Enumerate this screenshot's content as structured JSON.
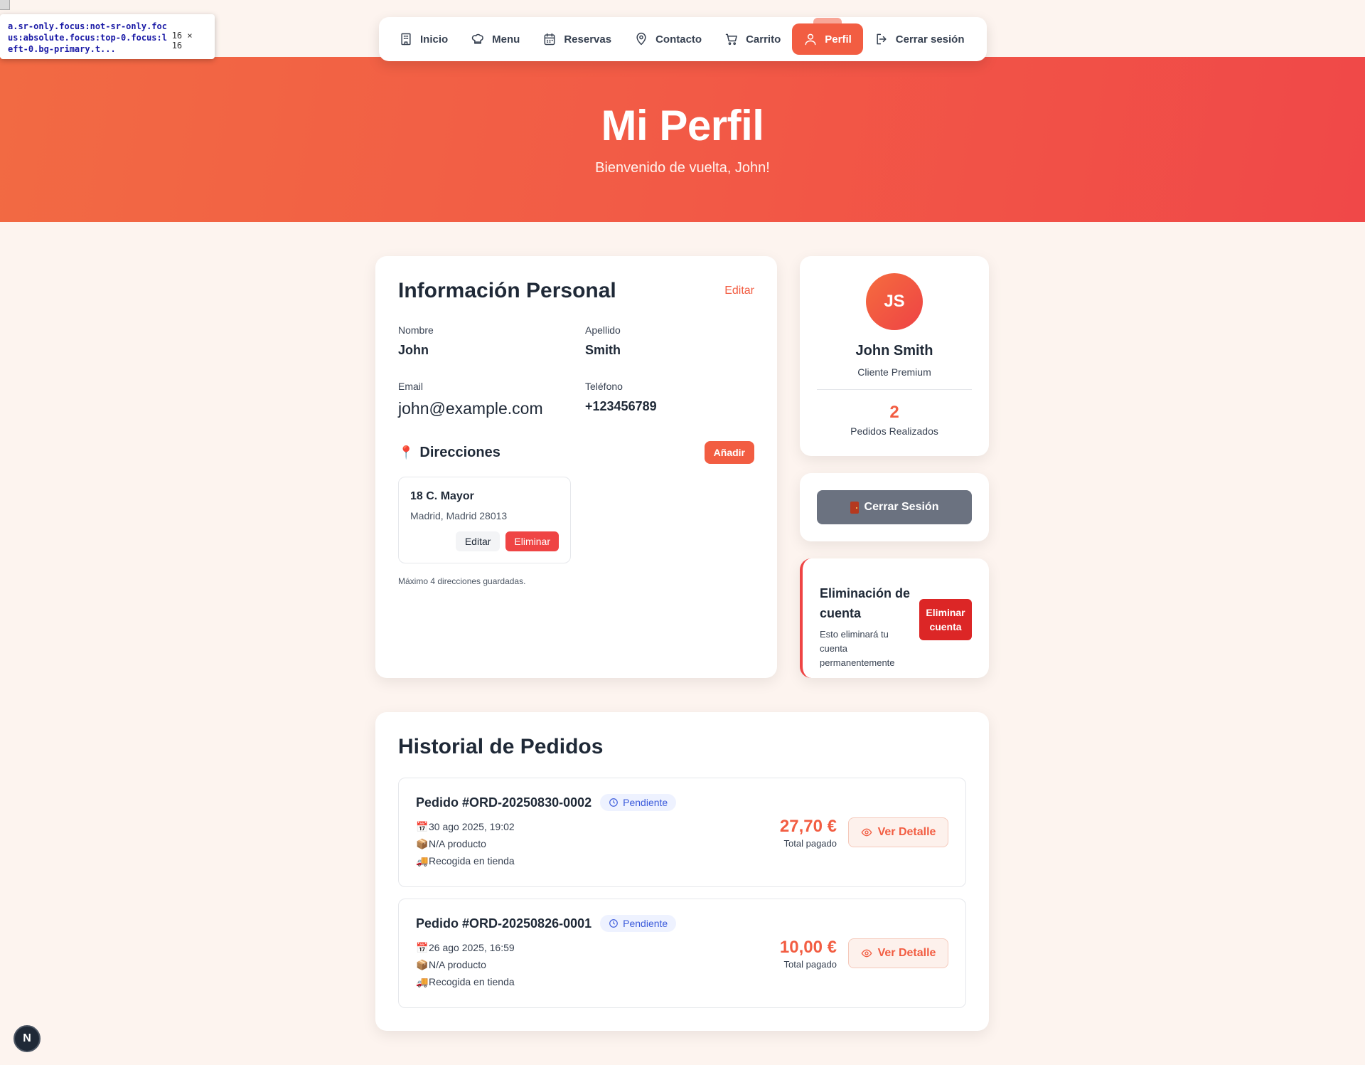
{
  "devtools": {
    "selector": "a.sr-only.focus:not-sr-only.focus:absolute.focus:top-0.focus:left-0.bg-primary.t...",
    "size": "16 × 16"
  },
  "nav": {
    "items": [
      {
        "label": "Inicio",
        "icon": "building-icon"
      },
      {
        "label": "Menu",
        "icon": "chef-hat-icon"
      },
      {
        "label": "Reservas",
        "icon": "calendar-icon"
      },
      {
        "label": "Contacto",
        "icon": "map-pin-icon"
      },
      {
        "label": "Carrito",
        "icon": "cart-icon"
      },
      {
        "label": "Perfil",
        "icon": "user-icon",
        "active": true
      },
      {
        "label": "Cerrar sesión",
        "icon": "logout-icon"
      }
    ]
  },
  "hero": {
    "title": "Mi Perfil",
    "subtitle": "Bienvenido de vuelta, John!"
  },
  "personal": {
    "title": "Información Personal",
    "edit_label": "Editar",
    "fields": {
      "nombre_label": "Nombre",
      "nombre": "John",
      "apellido_label": "Apellido",
      "apellido": "Smith",
      "email_label": "Email",
      "email": "john@example.com",
      "telefono_label": "Teléfono",
      "telefono": "+123456789"
    },
    "addresses_title": "Direcciones",
    "add_label": "Añadir",
    "addresses": [
      {
        "street": "18 C. Mayor",
        "city": "Madrid, Madrid 28013",
        "edit": "Editar",
        "delete": "Eliminar"
      }
    ],
    "hint": "Máximo 4 direcciones guardadas."
  },
  "profile": {
    "initials": "JS",
    "name": "John Smith",
    "tier": "Cliente Premium",
    "orders_count": "2",
    "orders_label": "Pedidos Realizados"
  },
  "logout": {
    "label": "Cerrar Sesión"
  },
  "danger": {
    "title": "Eliminación de cuenta",
    "subtitle": "Esto eliminará tu cuenta permanentemente",
    "button": "Eliminar cuenta"
  },
  "orders": {
    "title": "Historial de Pedidos",
    "items": [
      {
        "id": "Pedido #ORD-20250830-0002",
        "status": "Pendiente",
        "date": "30 ago 2025, 19:02",
        "products": "N/A producto",
        "delivery": "Recogida en tienda",
        "total": "27,70 €",
        "total_label": "Total pagado",
        "action": "Ver Detalle"
      },
      {
        "id": "Pedido #ORD-20250826-0001",
        "status": "Pendiente",
        "date": "26 ago 2025, 16:59",
        "products": "N/A producto",
        "delivery": "Recogida en tienda",
        "total": "10,00 €",
        "total_label": "Total pagado",
        "action": "Ver Detalle"
      }
    ]
  },
  "colors": {
    "accent": "#f25d42",
    "danger": "#dc2626",
    "status_blue": "#3b5bdb"
  },
  "next_badge": "N"
}
